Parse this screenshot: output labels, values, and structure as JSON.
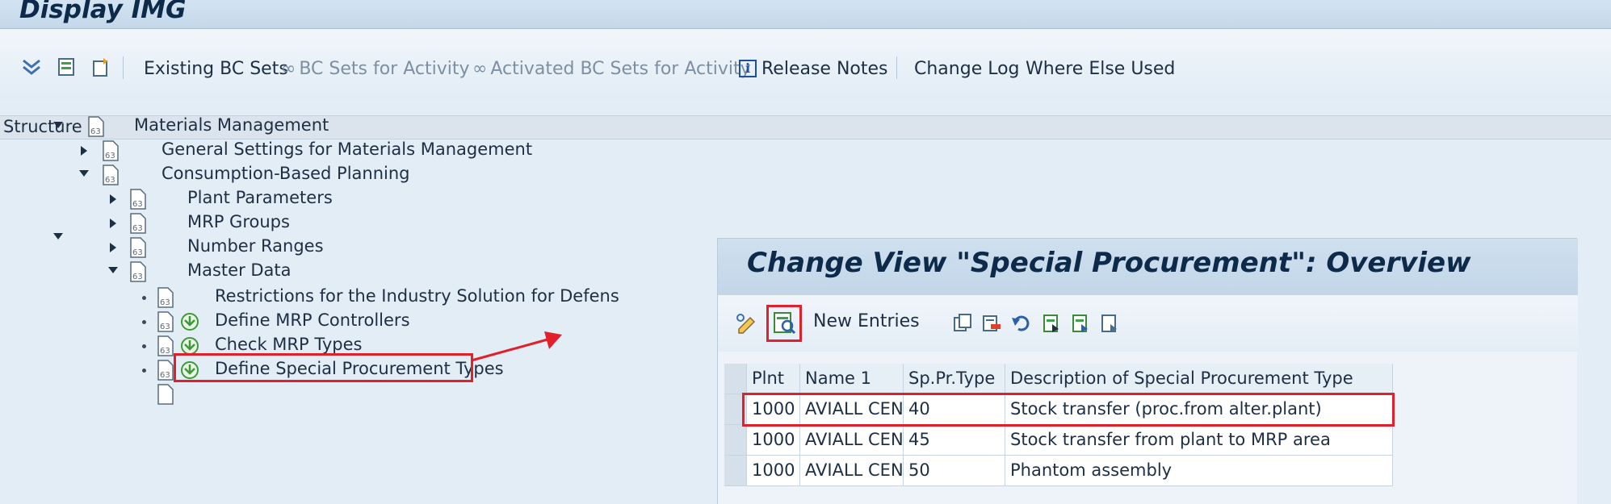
{
  "window": {
    "title": "Display IMG"
  },
  "toolbar": {
    "icons": [
      "expand-all-icon",
      "where-used-icon",
      "copy-icon"
    ],
    "existing_bc_sets": "Existing BC Sets",
    "bc_sets_for_activity": "BC Sets for Activity",
    "activated_bc_sets": "Activated BC Sets for Activity",
    "release_notes": "Release Notes",
    "change_log": "Change Log",
    "where_else_used": "Where Else Used"
  },
  "structure": {
    "header": "Structure",
    "items": [
      {
        "label": "Materials Management",
        "state": "expanded"
      },
      {
        "label": "General Settings for Materials Management",
        "state": "collapsed"
      },
      {
        "label": "Consumption-Based Planning",
        "state": "expanded"
      },
      {
        "label": "Plant Parameters",
        "state": "collapsed"
      },
      {
        "label": "MRP Groups",
        "state": "collapsed"
      },
      {
        "label": "Number Ranges",
        "state": "collapsed"
      },
      {
        "label": "Master Data",
        "state": "expanded"
      },
      {
        "label": "Restrictions for the Industry Solution for Defens",
        "state": "leaf"
      },
      {
        "label": "Define MRP Controllers",
        "state": "leaf-exec"
      },
      {
        "label": "Check MRP Types",
        "state": "leaf-exec"
      },
      {
        "label": "Define Special Procurement Types",
        "state": "leaf-exec-highlighted"
      }
    ]
  },
  "dialog": {
    "title": "Change View \"Special Procurement\": Overview",
    "new_entries": "New Entries",
    "columns": [
      "Plnt",
      "Name 1",
      "Sp.Pr.Type",
      "Description of Special Procurement Type"
    ],
    "rows": [
      [
        "1000",
        "AVIALL CEN…",
        "40",
        "Stock transfer (proc.from alter.plant)"
      ],
      [
        "1000",
        "AVIALL CEN…",
        "45",
        "Stock transfer from plant to MRP area"
      ],
      [
        "1000",
        "AVIALL CEN…",
        "50",
        "Phantom assembly"
      ]
    ]
  },
  "colors": {
    "highlight": "#e0202a",
    "header_bg": "#c4d8ea"
  }
}
